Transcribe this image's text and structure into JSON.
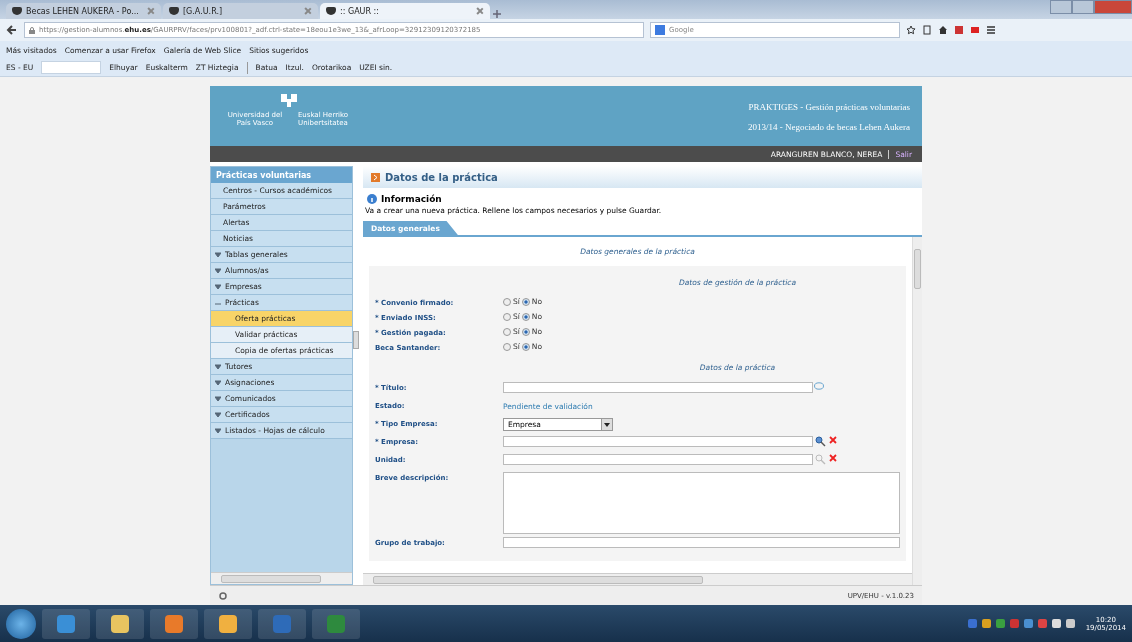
{
  "browser": {
    "tabs": [
      {
        "title": "Becas LEHEN AUKERA - Po...",
        "selected": false
      },
      {
        "title": "[G.A.U.R.]",
        "selected": false
      },
      {
        "title": ":: GAUR ::",
        "selected": true
      }
    ],
    "url_prefix": "https://gestion-alumnos.",
    "url_domain": "ehu.es",
    "url_rest": "/GAURPRV/faces/prv100801?_adf.ctrl-state=18eou1e3we_13&_afrLoop=32912309120372185",
    "search": {
      "placeholder": "Google"
    },
    "bookmarks": [
      "Más visitados",
      "Comenzar a usar Firefox",
      "Galería de Web Slice",
      "Sitios sugeridos"
    ],
    "addon": {
      "language": "ES - EU",
      "links_a": [
        "Elhuyar",
        "Euskalterm",
        "ZT Hiztegia"
      ],
      "links_b": [
        "Batua",
        "Itzul.",
        "Orotarikoa",
        "UZEI sin."
      ]
    }
  },
  "app": {
    "logo": {
      "left": "Universidad del País Vasco",
      "right": "Euskal Herriko Unibertsitatea"
    },
    "title": "PRAKTIGES - Gestión prácticas voluntarias",
    "subtitle": "2013/14 - Negociado de becas Lehen Aukera",
    "user": "ARANGUREN BLANCO, NEREA",
    "logout": "Salir",
    "sidebar": {
      "title": "Prácticas voluntarias",
      "items": [
        {
          "label": "Centros - Cursos académicos",
          "kind": "link"
        },
        {
          "label": "Parámetros",
          "kind": "link"
        },
        {
          "label": "Alertas",
          "kind": "link"
        },
        {
          "label": "Noticias",
          "kind": "link"
        },
        {
          "label": "Tablas generales",
          "kind": "group",
          "expanded": false
        },
        {
          "label": "Alumnos/as",
          "kind": "group",
          "expanded": false
        },
        {
          "label": "Empresas",
          "kind": "group",
          "expanded": false
        },
        {
          "label": "Prácticas",
          "kind": "group",
          "expanded": true,
          "children": [
            {
              "label": "Oferta prácticas",
              "selected": true
            },
            {
              "label": "Validar prácticas",
              "selected": false
            },
            {
              "label": "Copia de ofertas prácticas",
              "selected": false
            }
          ]
        },
        {
          "label": "Tutores",
          "kind": "group",
          "expanded": false
        },
        {
          "label": "Asignaciones",
          "kind": "group",
          "expanded": false
        },
        {
          "label": "Comunicados",
          "kind": "group",
          "expanded": false
        },
        {
          "label": "Certificados",
          "kind": "group",
          "expanded": false
        },
        {
          "label": "Listados - Hojas de cálculo",
          "kind": "group",
          "expanded": false
        }
      ]
    },
    "page_title": "Datos de la práctica",
    "info": {
      "title": "Información",
      "text": "Va a crear una nueva práctica. Rellene los campos necesarios y pulse Guardar."
    },
    "tabs": [
      {
        "label": "Datos generales",
        "selected": true
      }
    ],
    "form_title": "Datos generales de la práctica",
    "section_1": "Datos de gestión de la práctica",
    "radio_rows": [
      {
        "label": "* Convenio firmado:",
        "options": [
          {
            "label": "Sí",
            "selected": false
          },
          {
            "label": "No",
            "selected": true
          }
        ]
      },
      {
        "label": "* Enviado INSS:",
        "options": [
          {
            "label": "Sí",
            "selected": false
          },
          {
            "label": "No",
            "selected": true
          }
        ]
      },
      {
        "label": "* Gestión pagada:",
        "options": [
          {
            "label": "Sí",
            "selected": false
          },
          {
            "label": "No",
            "selected": true
          }
        ]
      },
      {
        "label": "Beca Santander:",
        "options": [
          {
            "label": "Sí",
            "selected": false
          },
          {
            "label": "No",
            "selected": true
          }
        ]
      }
    ],
    "section_2": "Datos de la práctica",
    "fields": [
      {
        "label": "* Título:",
        "kind": "input"
      },
      {
        "label": "Estado:",
        "kind": "text",
        "value": "Pendiente de validación"
      },
      {
        "label": "* Tipo Empresa:",
        "kind": "select",
        "value": "Empresa"
      },
      {
        "label": "* Empresa:",
        "kind": "lookup",
        "disabled": false
      },
      {
        "label": "Unidad:",
        "kind": "lookup",
        "disabled": true
      },
      {
        "label": "Breve descripción:",
        "kind": "textarea"
      },
      {
        "label": "Grupo de trabajo:",
        "kind": "input"
      }
    ],
    "version": "UPV/EHU - v.1.0.23"
  },
  "taskbar": {
    "time": "10:20",
    "date": "19/05/2014"
  }
}
